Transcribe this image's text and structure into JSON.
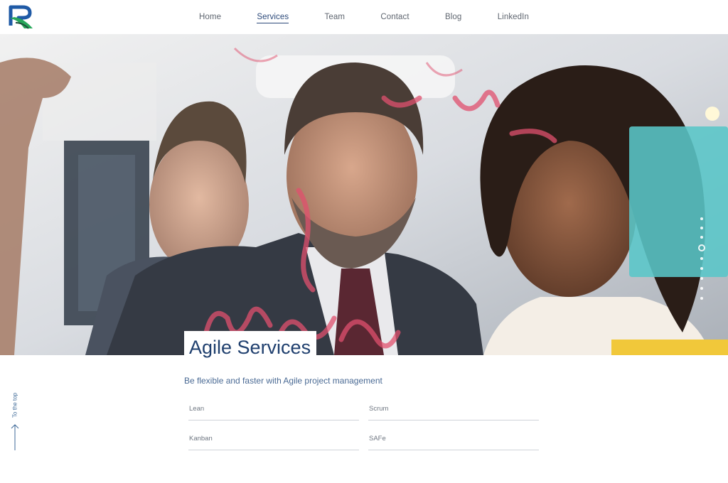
{
  "nav": {
    "items": [
      {
        "label": "Home",
        "active": false
      },
      {
        "label": "Services",
        "active": true
      },
      {
        "label": "Team",
        "active": false
      },
      {
        "label": "Contact",
        "active": false
      },
      {
        "label": "Blog",
        "active": false
      },
      {
        "label": "LinkedIn",
        "active": false
      }
    ]
  },
  "logo": {
    "icon": "R-logo",
    "colors": [
      "#1f5aa6",
      "#27a85a"
    ]
  },
  "hero": {
    "image_description_icon": "team-photo",
    "slide_count": 9,
    "active_slide": 3
  },
  "service": {
    "title": "Agile Services",
    "subtitle": "Be flexible and faster with Agile project management",
    "options": [
      {
        "label": "Lean"
      },
      {
        "label": "Scrum"
      },
      {
        "label": "Kanban"
      },
      {
        "label": "SAFe"
      }
    ]
  },
  "to_top": {
    "label": "To the top",
    "icon": "arrow-up-icon"
  },
  "colors": {
    "accent": "#1f3f6e",
    "nav_active": "#2d4a7a"
  }
}
